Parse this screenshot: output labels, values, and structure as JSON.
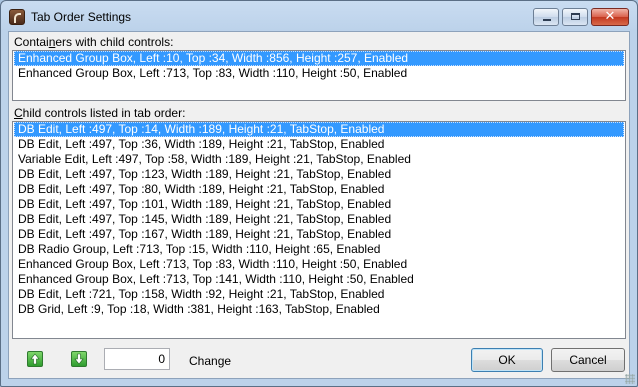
{
  "window": {
    "title": "Tab Order Settings"
  },
  "containers": {
    "label_pre": "Contai",
    "label_key": "n",
    "label_post": "ers with child controls:",
    "items": [
      "Enhanced Group Box, Left :10, Top :34, Width :856, Height :257, Enabled",
      "Enhanced Group Box, Left :713, Top :83, Width :110, Height :50, Enabled"
    ],
    "selected_index": 0
  },
  "children": {
    "label_pre": "",
    "label_key": "C",
    "label_post": "hild controls listed in tab order:",
    "items": [
      "DB Edit, Left :497, Top :14, Width :189, Height :21, TabStop, Enabled",
      "DB Edit, Left :497, Top :36, Width :189, Height :21, TabStop, Enabled",
      "Variable Edit, Left :497, Top :58, Width :189, Height :21, TabStop, Enabled",
      "DB Edit, Left :497, Top :123, Width :189, Height :21, TabStop, Enabled",
      "DB Edit, Left :497, Top :80, Width :189, Height :21, TabStop, Enabled",
      "DB Edit, Left :497, Top :101, Width :189, Height :21, TabStop, Enabled",
      "DB Edit, Left :497, Top :145, Width :189, Height :21, TabStop, Enabled",
      "DB Edit, Left :497, Top :167, Width :189, Height :21, TabStop, Enabled",
      "DB Radio Group, Left :713, Top :15, Width :110, Height :65, Enabled",
      "Enhanced Group Box, Left :713, Top :83, Width :110, Height :50, Enabled",
      "Enhanced Group Box, Left :713, Top :141, Width :110, Height :50, Enabled",
      "DB Edit, Left :721, Top :158, Width :92, Height :21, TabStop, Enabled",
      "DB Grid, Left :9, Top :18, Width :381, Height :163, TabStop, Enabled"
    ],
    "selected_index": 0
  },
  "bottom": {
    "move_up_icon": "arrow-up-icon",
    "move_down_icon": "arrow-down-icon",
    "position_value": "0",
    "change_label": "Change",
    "ok_label": "OK",
    "cancel_label": "Cancel"
  },
  "colors": {
    "selection": "#3399ff",
    "accent_green": "#2f9d2f"
  }
}
